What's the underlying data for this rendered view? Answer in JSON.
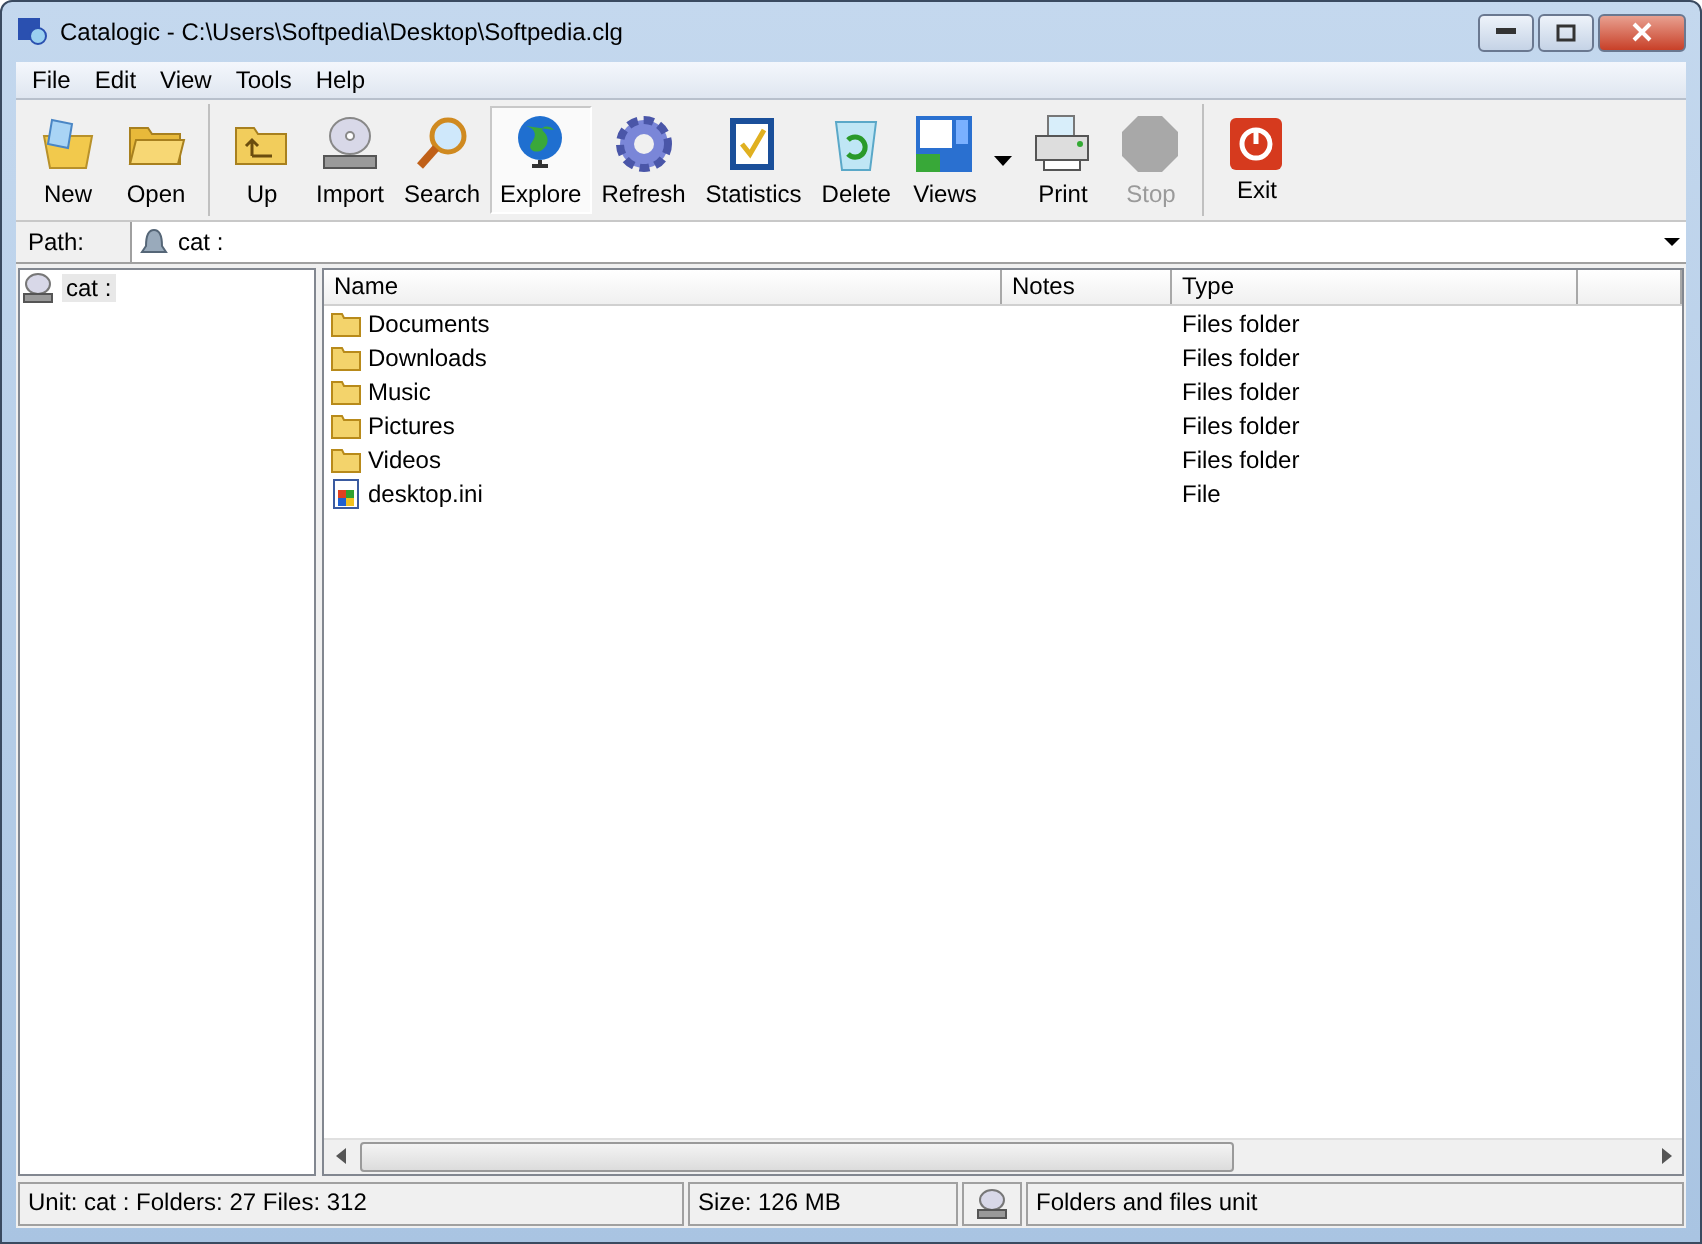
{
  "window": {
    "title": "Catalogic - C:\\Users\\Softpedia\\Desktop\\Softpedia.clg"
  },
  "menu": [
    "File",
    "Edit",
    "View",
    "Tools",
    "Help"
  ],
  "toolbar": [
    [
      {
        "label": "New",
        "selected": false,
        "disabled": false
      },
      {
        "label": "Open",
        "selected": false,
        "disabled": false
      }
    ],
    [
      {
        "label": "Up",
        "selected": false,
        "disabled": false
      },
      {
        "label": "Import",
        "selected": false,
        "disabled": false
      },
      {
        "label": "Search",
        "selected": false,
        "disabled": false
      },
      {
        "label": "Explore",
        "selected": true,
        "disabled": false
      },
      {
        "label": "Refresh",
        "selected": false,
        "disabled": false
      },
      {
        "label": "Statistics",
        "selected": false,
        "disabled": false
      },
      {
        "label": "Delete",
        "selected": false,
        "disabled": false
      },
      {
        "label": "Views",
        "selected": false,
        "disabled": false,
        "dropdown": true
      },
      {
        "label": "Print",
        "selected": false,
        "disabled": false
      },
      {
        "label": "Stop",
        "selected": false,
        "disabled": true
      }
    ],
    [
      {
        "label": "Exit",
        "selected": false,
        "disabled": false
      }
    ]
  ],
  "path": {
    "label": "Path:",
    "value": "cat :"
  },
  "tree": [
    {
      "label": "cat :",
      "selected": true
    }
  ],
  "table": {
    "columns": [
      "Name",
      "Notes",
      "Type"
    ],
    "rows": [
      {
        "kind": "folder",
        "name": "Documents",
        "type": "Files folder"
      },
      {
        "kind": "folder",
        "name": "Downloads",
        "type": "Files folder"
      },
      {
        "kind": "folder",
        "name": "Music",
        "type": "Files folder"
      },
      {
        "kind": "folder",
        "name": "Pictures",
        "type": "Files folder"
      },
      {
        "kind": "folder",
        "name": "Videos",
        "type": "Files folder"
      },
      {
        "kind": "file",
        "name": "desktop.ini",
        "type": "File"
      }
    ]
  },
  "status_bar": {
    "unit": "Unit: cat :  Folders: 27  Files: 312",
    "size": "Size: 126 MB",
    "description": "Folders and files unit"
  }
}
